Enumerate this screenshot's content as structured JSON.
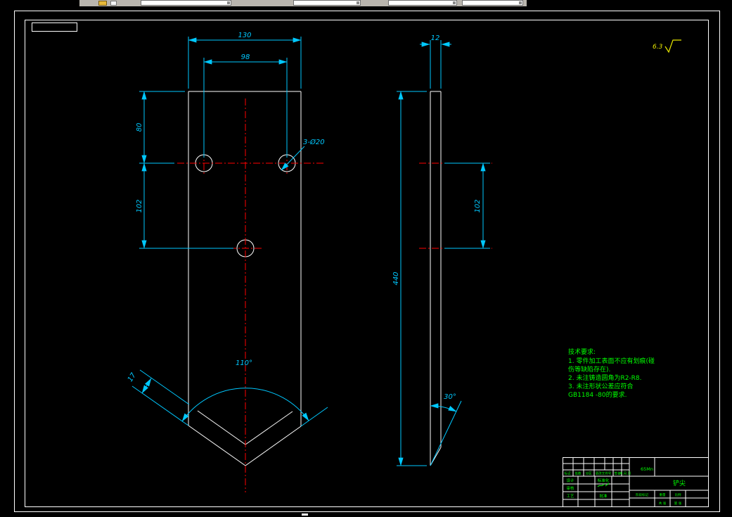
{
  "drawing": {
    "roughness_value": "6.3",
    "front_view": {
      "dim_overall_width": "130",
      "dim_hole_spacing": "98",
      "dim_top_to_holes": "80",
      "dim_holes_vertical": "102",
      "holes_callout": "3-Ø20",
      "tip_angle": "110°",
      "edge_bevel_width": "17"
    },
    "side_view": {
      "dim_thickness": "12",
      "dim_holes_vertical": "102",
      "dim_overall_height": "440",
      "tip_bevel_angle": "30°"
    },
    "tech_requirements": {
      "title": "技术要求:",
      "items": [
        "1. 零件加工表面不应有划痕(碰",
        "伤等缺陷存在).",
        "2. 未注铸造圆角为R2-R8.",
        "3. 未注形状公差应符合",
        "GB1184 -80的要求."
      ]
    },
    "title_block": {
      "part_name": "铲尖",
      "material": "65Mn",
      "rev_headers": [
        "标记",
        "处数",
        "分区",
        "更改文件号",
        "签名",
        "年.月.日"
      ],
      "design_label": "设计",
      "check_label": "审核",
      "process_label": "工艺",
      "standard_label": "标准化",
      "approve_label": "批准",
      "stage_label": "阶段标记",
      "weight_label": "重量",
      "scale_label": "比例",
      "total_sheets_label": "共 张",
      "sheet_no_label": "第 张"
    }
  }
}
